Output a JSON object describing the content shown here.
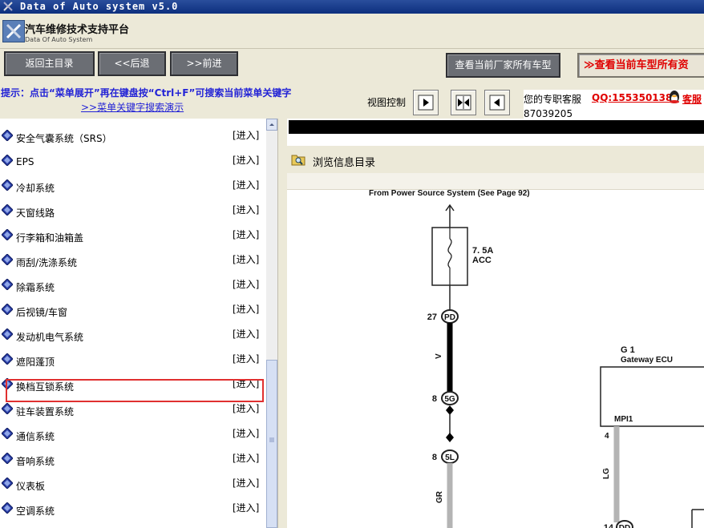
{
  "window": {
    "title": "Data of Auto system v5.0"
  },
  "app": {
    "title": "汽车维修技术支持平台",
    "subtitle": "Data Of Auto System"
  },
  "toolbar": {
    "home_label": "返回主目录",
    "back_label": "<<后退",
    "forward_label": ">>前进",
    "all_models_label": "查看当前厂家所有车型",
    "current_model_label": "≫查看当前车型所有资"
  },
  "hint": {
    "text": "提示：点击“菜单展开”再在键盘按“Ctrl+F”可搜索当前菜单关键字",
    "link": ">>菜单关键字搜索演示"
  },
  "view_control": {
    "label": "视图控制"
  },
  "support": {
    "label": "您的专职客服",
    "qq": "QQ:1553501388",
    "service": "客服",
    "number": "87039205"
  },
  "menu": {
    "enter_label": "[进入]",
    "items": [
      "安全气囊系统（SRS）",
      "EPS",
      "冷却系统",
      "天窗线路",
      "行李箱和油箱盖",
      "雨刮/洗涤系统",
      "除霜系统",
      "后视镜/车窗",
      "发动机电气系统",
      "遮阳蓬顶",
      "换档互锁系统",
      "驻车装置系统",
      "通信系统",
      "音响系统",
      "仪表板",
      "空调系统"
    ],
    "selected_index": 15
  },
  "browse": {
    "title": "浏览信息目录"
  },
  "diagram": {
    "header": "From Power Source System (See Page 92)",
    "fuse_rating": "7. 5A",
    "fuse_name": "ACC",
    "conn_pd_pin": "27",
    "conn_pd": "PD",
    "wire_v": "V",
    "conn_5g_pin": "8",
    "conn_5g": "5G",
    "conn_5l_pin": "8",
    "conn_5l": "5L",
    "wire_gr": "GR",
    "ecu_id": "G 1",
    "ecu_name": "Gateway ECU",
    "ecu_pin_name": "MPI1",
    "ecu_pin_no": "4",
    "wire_lg": "LG",
    "conn_dd_pin": "14",
    "conn_dd": "DD"
  },
  "colors": {
    "title_bar": "#0d2f7e",
    "hint_text": "#2323d6",
    "accent_red": "#e00000",
    "selection_border": "#e03030"
  }
}
